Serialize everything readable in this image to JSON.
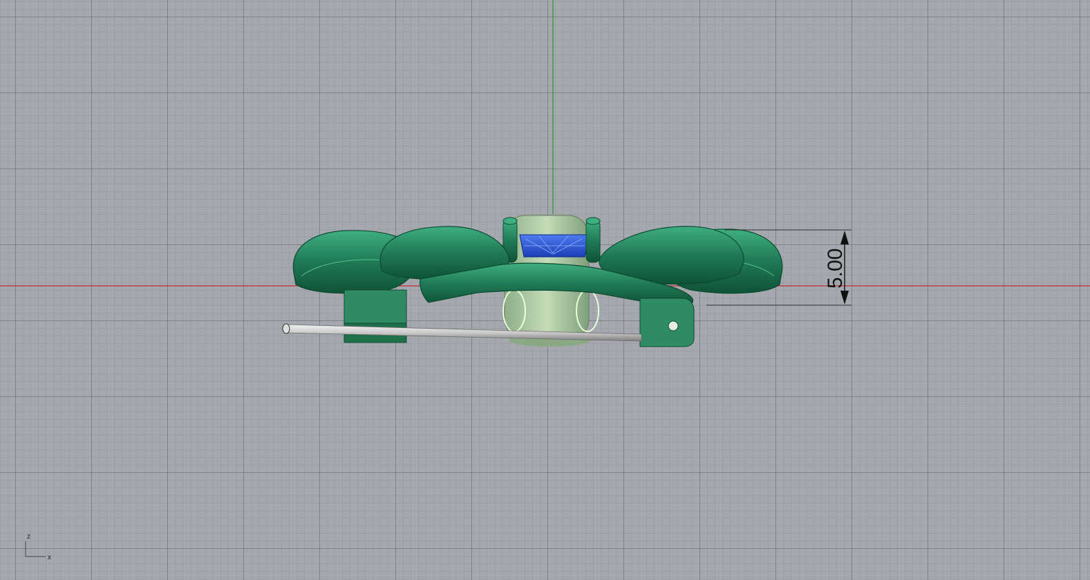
{
  "viewport": {
    "background": "#a5a9af",
    "grid_visible": true,
    "x_axis_color": "#c0404a",
    "y_axis_color": "#3a9a3a"
  },
  "dimension": {
    "label": "5.00"
  },
  "axis_widget": {
    "vertical": "z",
    "horizontal": "x"
  },
  "model": {
    "body_color": "#1f7a55",
    "highlight_color": "#3fae80",
    "gem_color": "#1d4bd8",
    "rod_color": "#c9c9c9"
  }
}
